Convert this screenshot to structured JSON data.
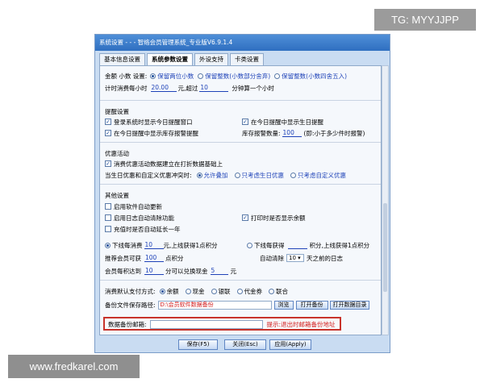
{
  "watermark_top": "TG: MYYJJPP",
  "watermark_bottom": "www.fredkarel.com",
  "window": {
    "title": "系统设置 - - - 智络会员管理系统_专业版V6.9.1.4"
  },
  "tabs": [
    "基本信息设置",
    "系统参数设置",
    "外设支持",
    "卡类设置"
  ],
  "amount": {
    "label": "金额 小数 设置:",
    "options": [
      "保留两位小数",
      "保留整数(小数部分舍弃)",
      "保留整数(小数四舍五入)"
    ]
  },
  "timing": {
    "prefix": "计时消费每小时",
    "price": "20.00",
    "unit": "元,超过",
    "minutes": "10",
    "suffix": "分钟算一个小时"
  },
  "reminder": {
    "title": "提醒设置",
    "login_today": "登录系统时显示今日提醒窗口",
    "birthday_today": "在今日提醒中显示生日提醒",
    "stock_alert": "在今日提醒中显示库存报警提醒",
    "stock_qty_label": "库存报警数量:",
    "stock_qty_value": "100",
    "stock_qty_hint": "(即:小于多少件时报警)"
  },
  "promo": {
    "title": "优惠活动",
    "base_on_discount": "消费优惠活动数据建立在打折数据基础上",
    "conflict_label": "当生日优惠和自定义优惠冲突时:",
    "options": [
      "允许叠加",
      "只考虑生日优惠",
      "只考虑自定义优惠"
    ]
  },
  "other": {
    "title": "其他设置",
    "auto_update": "启用软件自动更新",
    "log_clear": "启用日志自动清除功能",
    "print_balance": "打印时是否显示余额",
    "auto_extend": "充值时是否自动延长一年"
  },
  "points": {
    "consume_label": "下线每消费",
    "consume_value": "10",
    "consume_unit": "元,上线获得1点积分",
    "earn_label": "下线每获得",
    "earn_value": "",
    "earn_unit": "积分,上线获得1点积分",
    "recommend_label": "推荐会员可获",
    "recommend_value": "100",
    "recommend_unit": "点积分",
    "auto_clear_label": "自动清除",
    "auto_clear_value": "10",
    "auto_clear_unit": "天之前的日志",
    "exchange_label": "会员每积达到",
    "exchange_value": "10",
    "exchange_mid": "分可以兑换现金",
    "exchange_cash": "5",
    "exchange_unit": "元"
  },
  "payment": {
    "label": "消费默认支付方式:",
    "options": [
      "余额",
      "现金",
      "银联",
      "代金券",
      "联合"
    ]
  },
  "backup": {
    "label": "备份文件保存路径:",
    "path": "D:\\会员软件数据备份",
    "browse": "浏览",
    "open_backup": "打开备份",
    "open_data_dir": "打开数据目录"
  },
  "email": {
    "label": "数据备份邮箱:",
    "value": "",
    "hint": "提示:退出时邮箱备份地址"
  },
  "buttons": {
    "save": "保存(F5)",
    "close": "关闭(Esc)",
    "apply": "应用(Apply)"
  }
}
